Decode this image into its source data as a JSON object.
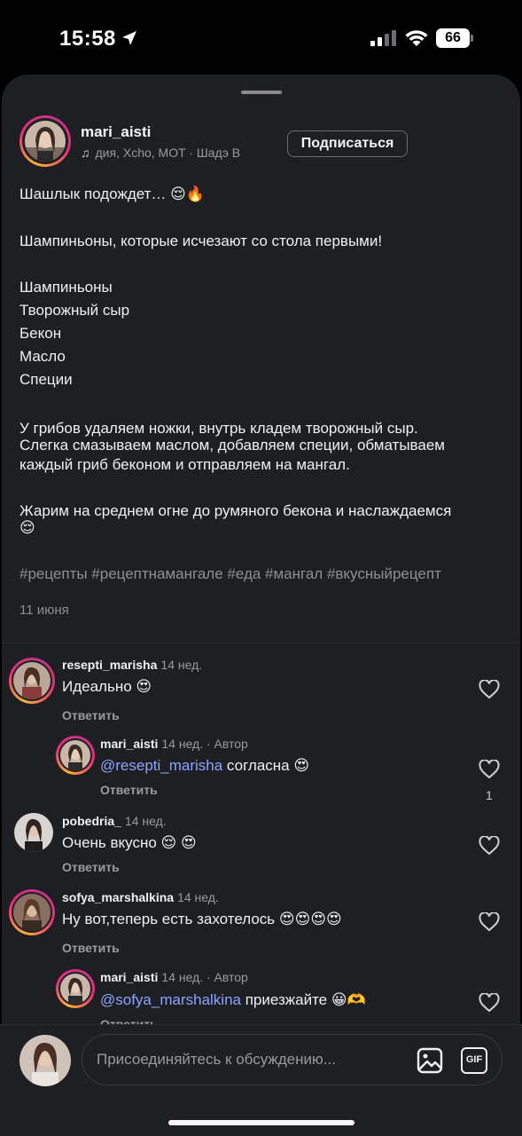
{
  "status_bar": {
    "time": "15:58",
    "battery": "66"
  },
  "post": {
    "author": "mari_aisti",
    "music": "дия, Xcho, MOT · Шадэ    В",
    "subscribe_label": "Подписаться",
    "caption": {
      "line1": "Шашлык подождет… 😌🔥",
      "line2": "Шампиньоны, которые исчезают со стола первыми!",
      "ingredients": [
        "Шампиньоны",
        "Творожный сыр",
        "Бекон",
        "Масло",
        "Специи"
      ],
      "instructions": [
        "У грибов удаляем ножки, внутрь кладем творожный сыр.",
        "Слегка смазываем маслом, добавляем специи, обматываем",
        "каждый гриб беконом и отправляем на мангал."
      ],
      "finish": [
        "Жарим на среднем огне до румяного бекона и наслаждаемся",
        "😌"
      ]
    },
    "hashtags": "#рецепты #рецептнамангале #еда #мангал #вкусныйрецепт",
    "date": "11 июня"
  },
  "comments": [
    {
      "user": "resepti_marisha",
      "meta": "14 нед.",
      "text": "Идеально 😍",
      "reply_label": "Ответить"
    },
    {
      "user": "mari_aisti",
      "meta": "14 нед. · Автор",
      "mention": "@resepti_marisha",
      "text": " согласна 😍",
      "reply_label": "Ответить",
      "likes": "1"
    },
    {
      "user": "pobedria_",
      "meta": "14 нед.",
      "text": "Очень вкусно 😌 😍",
      "reply_label": "Ответить"
    },
    {
      "user": "sofya_marshalkina",
      "meta": "14 нед.",
      "text": "Ну вот,теперь есть захотелось 😍😍😍😍",
      "reply_label": "Ответить"
    },
    {
      "user": "mari_aisti",
      "meta": "14 нед. · Автор",
      "mention": "@sofya_marshalkina",
      "text": " приезжайте 😀🫶",
      "reply_label": "Ответить"
    }
  ],
  "composer": {
    "placeholder": "Присоединяйтесь к обсуждению...",
    "gif_label": "GIF"
  },
  "colors": {
    "background": "#1e1f22",
    "mention": "#8ba4ff",
    "muted": "#9a9a9f"
  }
}
